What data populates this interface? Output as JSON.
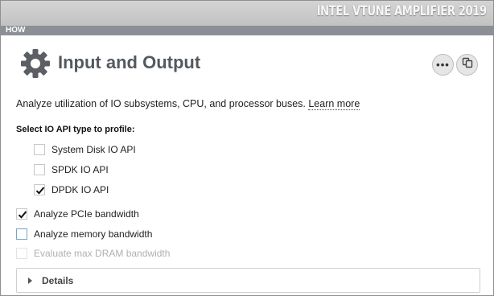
{
  "app": {
    "brand": "INTEL VTUNE AMPLIFIER 2019"
  },
  "nav": {
    "how": "HOW"
  },
  "header": {
    "title": "Input and Output",
    "icon": "gear-icon",
    "more_label": "•••",
    "copy_icon": "copy-icon"
  },
  "description": {
    "text": "Analyze utilization of IO subsystems, CPU, and processor buses. ",
    "link": "Learn more"
  },
  "io_api": {
    "label": "Select IO API type to profile:",
    "options": [
      {
        "label": "System Disk IO API",
        "checked": false
      },
      {
        "label": "SPDK IO API",
        "checked": false
      },
      {
        "label": "DPDK IO API",
        "checked": true
      }
    ]
  },
  "options": {
    "pcie": {
      "label": "Analyze PCIe bandwidth",
      "checked": true
    },
    "memory": {
      "label": "Analyze memory bandwidth",
      "checked": false
    },
    "dram": {
      "label": "Evaluate max DRAM bandwidth",
      "checked": false,
      "disabled": true
    }
  },
  "details": {
    "label": "Details"
  },
  "colors": {
    "title": "#54595f",
    "topbar": "#c8c8c8",
    "howbar": "#8c9096",
    "gear": "#5b5f64"
  }
}
